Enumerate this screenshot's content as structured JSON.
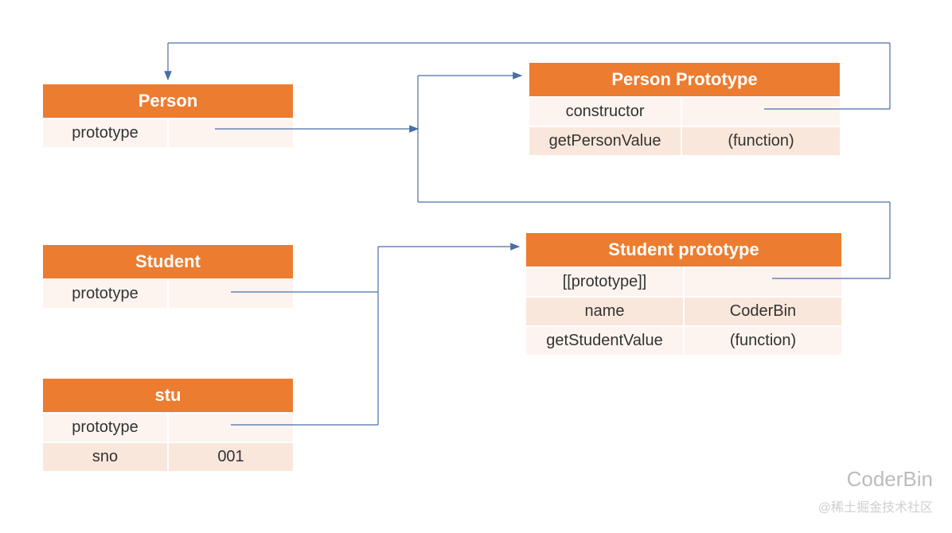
{
  "boxes": {
    "person": {
      "title": "Person",
      "rows": [
        {
          "left": "prototype",
          "right": ""
        }
      ]
    },
    "personProto": {
      "title": "Person Prototype",
      "rows": [
        {
          "left": "constructor",
          "right": ""
        },
        {
          "left": "getPersonValue",
          "right": "(function)"
        }
      ]
    },
    "student": {
      "title": "Student",
      "rows": [
        {
          "left": "prototype",
          "right": ""
        }
      ]
    },
    "studentProto": {
      "title": "Student prototype",
      "rows": [
        {
          "left": "[[prototype]]",
          "right": ""
        },
        {
          "left": "name",
          "right": "CoderBin"
        },
        {
          "left": "getStudentValue",
          "right": "(function)"
        }
      ]
    },
    "stu": {
      "title": "stu",
      "rows": [
        {
          "left": "prototype",
          "right": ""
        },
        {
          "left": "sno",
          "right": "001"
        }
      ]
    }
  },
  "watermark": {
    "author": "CoderBin",
    "site": "@稀土掘金技术社区"
  }
}
